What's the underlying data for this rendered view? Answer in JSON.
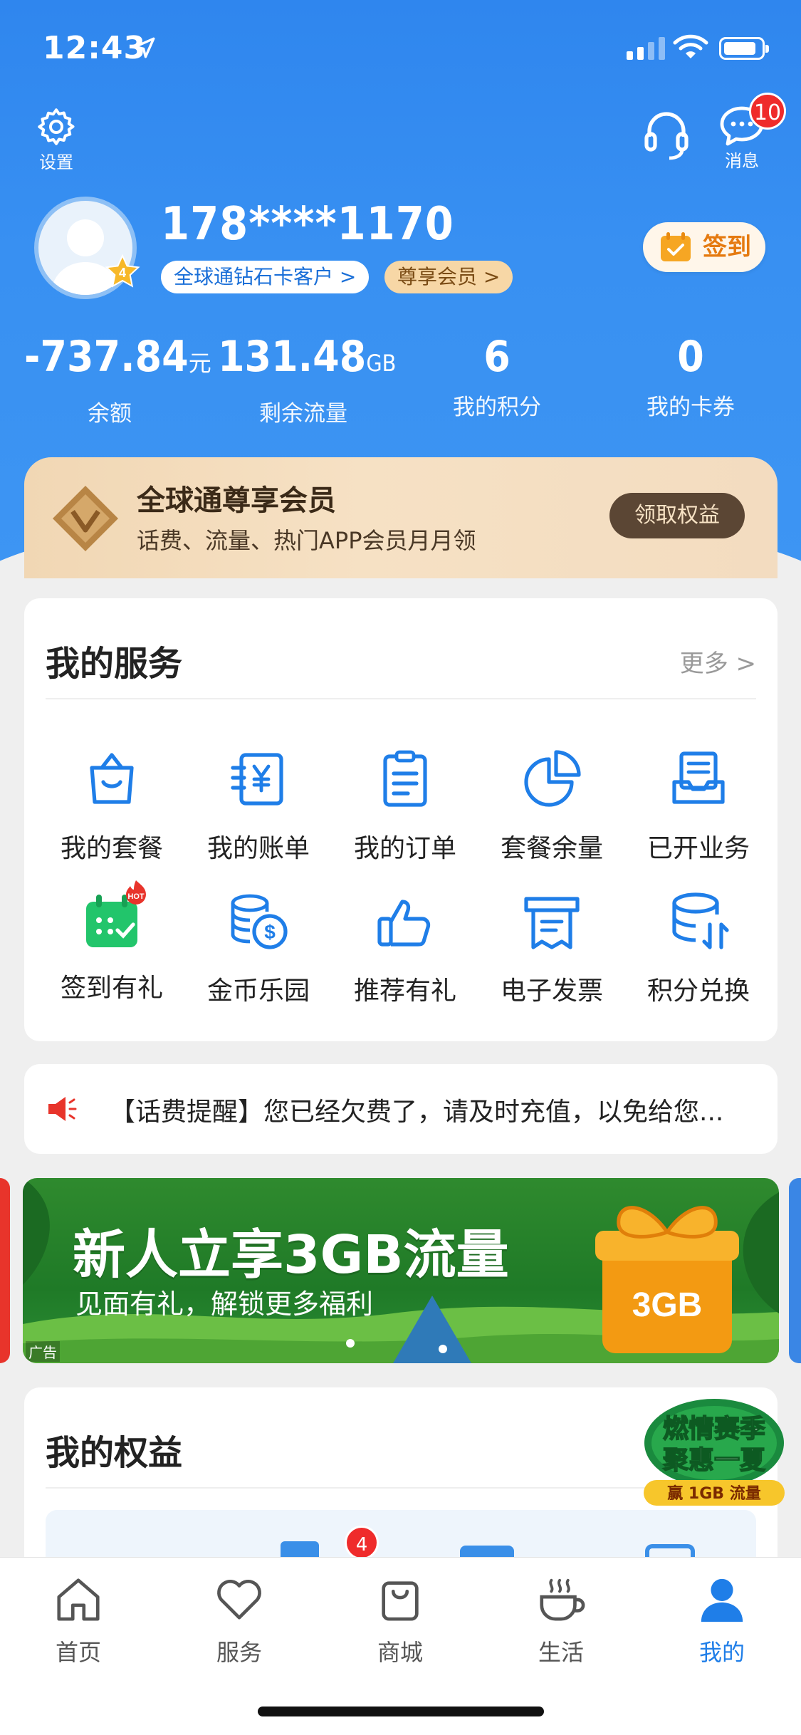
{
  "status_bar": {
    "time": "12:43"
  },
  "header": {
    "settings_label": "设置",
    "messages_label": "消息",
    "messages_badge": "10",
    "phone_number": "178****1170",
    "customer_tier": "全球通钻石卡客户 >",
    "member_tier": "尊享会员 >",
    "avatar_level": "4",
    "signin_label": "签到",
    "stats": [
      {
        "value": "-737.84",
        "unit": "元",
        "label": "余额"
      },
      {
        "value": "131.48",
        "unit": "GB",
        "label": "剩余流量"
      },
      {
        "value": "6",
        "unit": "",
        "label": "我的积分"
      },
      {
        "value": "0",
        "unit": "",
        "label": "我的卡券"
      }
    ]
  },
  "vip_banner": {
    "title": "全球通尊享会员",
    "subtitle": "话费、流量、热门APP会员月月领",
    "button": "领取权益"
  },
  "services": {
    "title": "我的服务",
    "more": "更多 >",
    "items": [
      {
        "label": "我的套餐",
        "icon": "shopping-bag-icon"
      },
      {
        "label": "我的账单",
        "icon": "bill-yen-icon"
      },
      {
        "label": "我的订单",
        "icon": "clipboard-list-icon"
      },
      {
        "label": "套餐余量",
        "icon": "pie-chart-icon"
      },
      {
        "label": "已开业务",
        "icon": "inbox-tray-icon"
      },
      {
        "label": "签到有礼",
        "icon": "calendar-check-icon",
        "badge": "HOT"
      },
      {
        "label": "金币乐园",
        "icon": "coins-icon"
      },
      {
        "label": "推荐有礼",
        "icon": "thumbs-up-icon"
      },
      {
        "label": "电子发票",
        "icon": "receipt-icon"
      },
      {
        "label": "积分兑换",
        "icon": "points-exchange-icon"
      }
    ]
  },
  "notice": {
    "text": "【话费提醒】您已经欠费了，请及时充值，以免给您..."
  },
  "ad_banner": {
    "title": "新人立享3GB流量",
    "subtitle": "见面有礼，解锁更多福利",
    "gift_label": "3GB",
    "ad_tag": "广告"
  },
  "rights": {
    "title": "我的权益",
    "badge": "4"
  },
  "promo_float": {
    "line1": "燃情赛季",
    "line2": "聚惠一夏",
    "line3": "赢 1GB 流量"
  },
  "tabbar": {
    "items": [
      {
        "label": "首页",
        "icon": "home-icon"
      },
      {
        "label": "服务",
        "icon": "heart-icon"
      },
      {
        "label": "商城",
        "icon": "shopping-bag-icon"
      },
      {
        "label": "生活",
        "icon": "coffee-cup-icon"
      },
      {
        "label": "我的",
        "icon": "user-icon",
        "active": true
      }
    ]
  },
  "colors": {
    "primary": "#2f86ee",
    "accent_orange": "#e57a10",
    "badge_red": "#ef2b2b",
    "vip_gold": "#f1d7b4"
  }
}
